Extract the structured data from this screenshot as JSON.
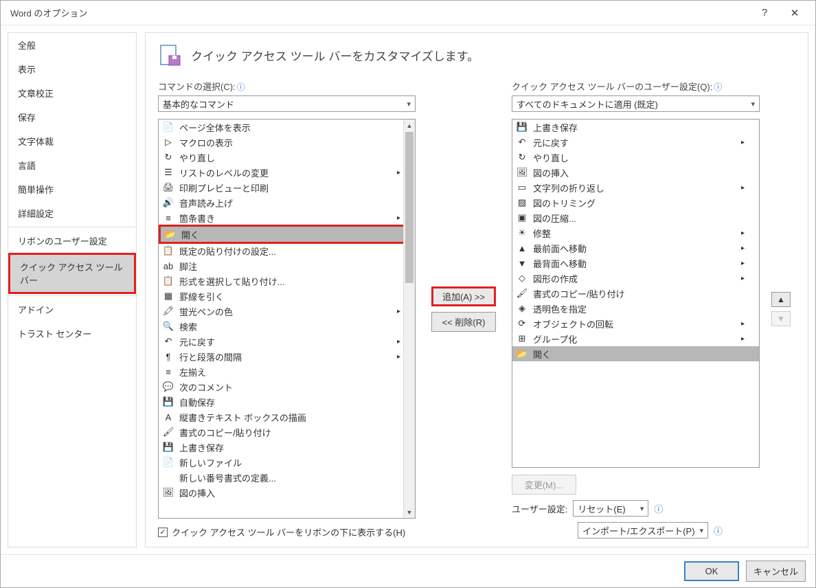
{
  "title": "Word のオプション",
  "heading": "クイック アクセス ツール バーをカスタマイズします。",
  "sidebar": {
    "items": [
      {
        "label": "全般"
      },
      {
        "label": "表示"
      },
      {
        "label": "文章校正"
      },
      {
        "label": "保存"
      },
      {
        "label": "文字体裁"
      },
      {
        "label": "言語"
      },
      {
        "label": "簡単操作"
      },
      {
        "label": "詳細設定"
      },
      {
        "label": "リボンのユーザー設定",
        "sep": true
      },
      {
        "label": "クイック アクセス ツール バー",
        "selected": true,
        "redbox": true
      },
      {
        "label": "アドイン",
        "sep": true
      },
      {
        "label": "トラスト センター"
      }
    ]
  },
  "left": {
    "label": "コマンドの選択(C):",
    "combo": "基本的なコマンド",
    "items": [
      {
        "icon": "📄",
        "label": "ページ全体を表示"
      },
      {
        "icon": "▷",
        "label": "マクロの表示"
      },
      {
        "icon": "↻",
        "label": "やり直し"
      },
      {
        "icon": "☰",
        "label": "リストのレベルの変更",
        "more": true
      },
      {
        "icon": "🖨",
        "label": "印刷プレビューと印刷"
      },
      {
        "icon": "🔊",
        "label": "音声読み上げ"
      },
      {
        "icon": "≡",
        "label": "箇条書き",
        "more": true
      },
      {
        "icon": "📂",
        "label": "開く",
        "selected": true,
        "redwrap": true
      },
      {
        "icon": "📋",
        "label": "既定の貼り付けの設定..."
      },
      {
        "icon": "ab",
        "label": "脚注"
      },
      {
        "icon": "📋",
        "label": "形式を選択して貼り付け..."
      },
      {
        "icon": "▦",
        "label": "罫線を引く"
      },
      {
        "icon": "🖍",
        "label": "蛍光ペンの色",
        "more": true
      },
      {
        "icon": "🔍",
        "label": "検索"
      },
      {
        "icon": "↶",
        "label": "元に戻す",
        "more": true
      },
      {
        "icon": "¶",
        "label": "行と段落の間隔",
        "more": true
      },
      {
        "icon": "≡",
        "label": "左揃え"
      },
      {
        "icon": "💬",
        "label": "次のコメント"
      },
      {
        "icon": "💾",
        "label": "自動保存"
      },
      {
        "icon": "A",
        "label": "縦書きテキスト ボックスの描画"
      },
      {
        "icon": "🖌",
        "label": "書式のコピー/貼り付け"
      },
      {
        "icon": "💾",
        "label": "上書き保存"
      },
      {
        "icon": "📄",
        "label": "新しいファイル"
      },
      {
        "icon": "",
        "label": "新しい番号書式の定義..."
      },
      {
        "icon": "🖼",
        "label": "図の挿入"
      }
    ]
  },
  "right": {
    "label": "クイック アクセス ツール バーのユーザー設定(Q):",
    "combo": "すべてのドキュメントに適用 (既定)",
    "items": [
      {
        "icon": "💾",
        "label": "上書き保存"
      },
      {
        "icon": "↶",
        "label": "元に戻す",
        "more": true
      },
      {
        "icon": "↻",
        "label": "やり直し"
      },
      {
        "icon": "🖼",
        "label": "図の挿入"
      },
      {
        "icon": "▭",
        "label": "文字列の折り返し",
        "more": true
      },
      {
        "icon": "▨",
        "label": "図のトリミング"
      },
      {
        "icon": "▣",
        "label": "図の圧縮..."
      },
      {
        "icon": "☀",
        "label": "修整",
        "more": true
      },
      {
        "icon": "▲",
        "label": "最前面へ移動",
        "more": true
      },
      {
        "icon": "▼",
        "label": "最背面へ移動",
        "more": true
      },
      {
        "icon": "◇",
        "label": "図形の作成",
        "more": true
      },
      {
        "icon": "🖌",
        "label": "書式のコピー/貼り付け"
      },
      {
        "icon": "◈",
        "label": "透明色を指定"
      },
      {
        "icon": "⟳",
        "label": "オブジェクトの回転",
        "more": true
      },
      {
        "icon": "⊞",
        "label": "グループ化",
        "more": true
      },
      {
        "icon": "📂",
        "label": "開く",
        "selected": true
      }
    ]
  },
  "buttons": {
    "add": "追加(A) >>",
    "remove": "<< 削除(R)",
    "modify": "変更(M)...",
    "reset": "リセット(E)",
    "import": "インポート/エクスポート(P)",
    "ok": "OK",
    "cancel": "キャンセル"
  },
  "checkbox": {
    "checked": true,
    "label": "クイック アクセス ツール バーをリボンの下に表示する(H)"
  },
  "labels": {
    "user_settings": "ユーザー設定:"
  }
}
